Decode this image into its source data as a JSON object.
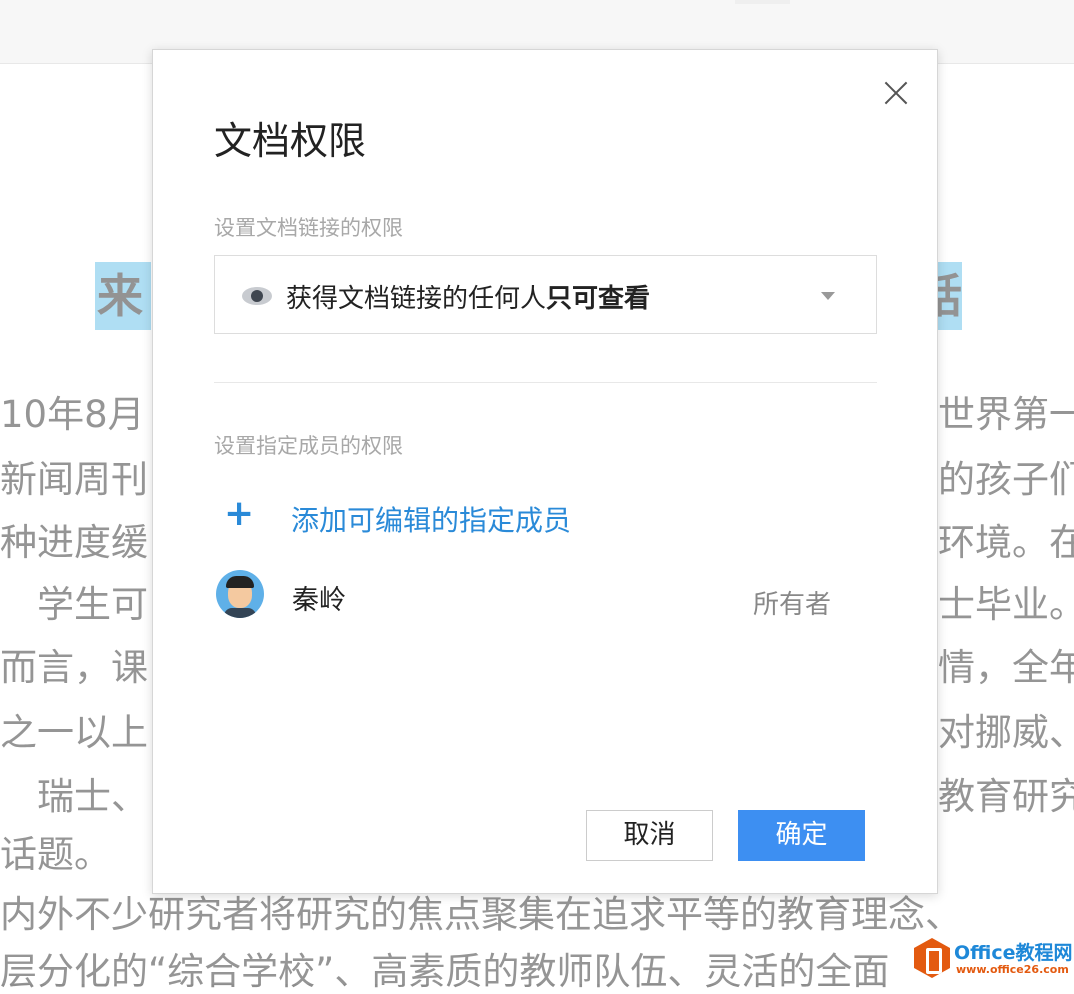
{
  "document": {
    "title_left": "来",
    "title_right": "話",
    "lines": [
      {
        "left": "10年8月",
        "right": "世界第一"
      },
      {
        "left": "新闻周刊",
        "right": "的孩子们"
      },
      {
        "left": "种进度缓",
        "right": "环境。在"
      },
      {
        "left": "　学生可",
        "right": "士毕业。"
      },
      {
        "left": "而言，课",
        "right": "情，全年"
      },
      {
        "left": "之一以上",
        "right": "对挪威、"
      },
      {
        "left": "　瑞士、",
        "right": "教育研究"
      },
      {
        "left": "话题。",
        "right": ""
      },
      {
        "left": "内外不少研究者将研究的焦点聚集在追求平等的教育理念、",
        "right": ""
      },
      {
        "left": "层分化的“综合学校”、高素质的教师队伍、灵活的全面",
        "right": ""
      }
    ]
  },
  "dialog": {
    "title": "文档权限",
    "link_section_label": "设置文档链接的权限",
    "link_permission": {
      "prefix": "获得文档链接的任何人",
      "bold": "只可查看",
      "icon": "eye-icon"
    },
    "member_section_label": "设置指定成员的权限",
    "add_member_label": "添加可编辑的指定成员",
    "members": [
      {
        "name": "秦岭",
        "role": "所有者"
      }
    ],
    "cancel_label": "取消",
    "ok_label": "确定"
  },
  "watermark_logo": {
    "name": "Office教程网",
    "url": "www.office26.com"
  },
  "colors": {
    "accent": "#3d8ff2",
    "link": "#2a8ad8",
    "title_highlight": "#a9dcf2"
  }
}
